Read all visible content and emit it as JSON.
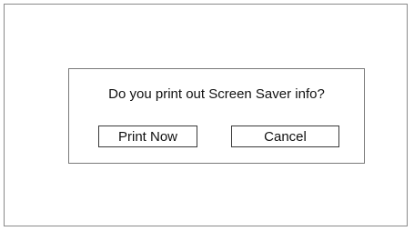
{
  "dialog": {
    "message": "Do you print out Screen Saver info?",
    "buttons": {
      "print_now_label": "Print Now",
      "cancel_label": "Cancel"
    }
  },
  "colors": {
    "background": "#ffffff",
    "border": "#7a7a7a",
    "text": "#111111"
  }
}
